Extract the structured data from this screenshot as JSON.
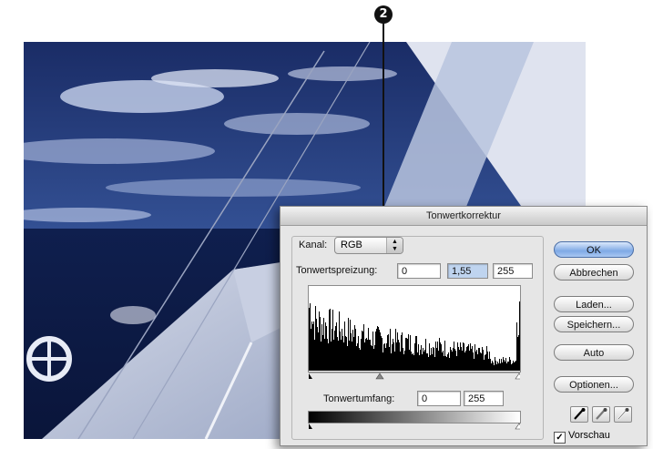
{
  "callout": {
    "number": "2"
  },
  "dialog": {
    "title": "Tonwertkorrektur",
    "channel": {
      "label": "Kanal:",
      "value": "RGB"
    },
    "input_levels": {
      "label": "Tonwertspreizung:",
      "black": "0",
      "gamma": "1,55",
      "white": "255"
    },
    "output_levels": {
      "label": "Tonwertumfang:",
      "black": "0",
      "white": "255"
    },
    "buttons": {
      "ok": "OK",
      "cancel": "Abbrechen",
      "load": "Laden...",
      "save": "Speichern...",
      "auto": "Auto",
      "options": "Optionen..."
    },
    "eyedroppers": [
      "black-eyedropper-icon",
      "gray-eyedropper-icon",
      "white-eyedropper-icon"
    ],
    "preview": {
      "label": "Vorschau",
      "checked": true
    },
    "accent_color": "#7fa9e5"
  }
}
